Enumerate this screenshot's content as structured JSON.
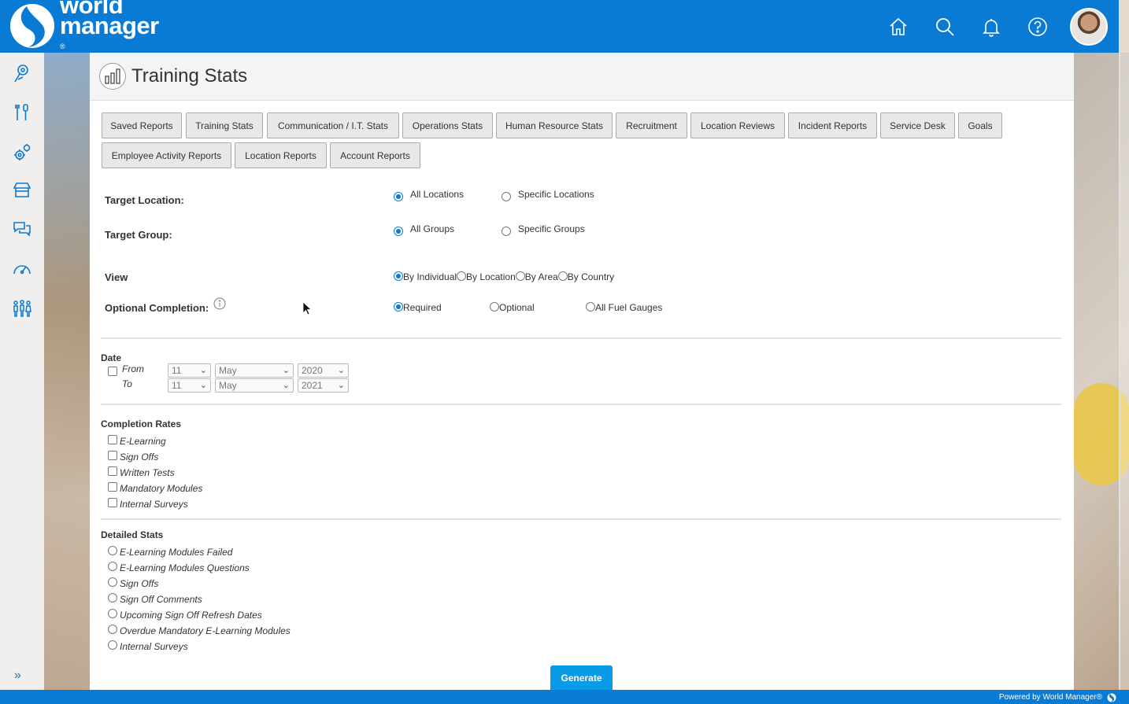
{
  "brand": {
    "line1": "world",
    "line2": "manager",
    "reg": "®"
  },
  "header_icons": [
    "home-icon",
    "search-icon",
    "bell-icon",
    "help-icon"
  ],
  "sidebar_icons": [
    "map-pin-icon",
    "tools-icon",
    "gear-icon",
    "store-icon",
    "chat-icon",
    "gauge-icon",
    "people-icon"
  ],
  "page": {
    "title": "Training Stats"
  },
  "tabs": [
    "Saved Reports",
    "Training Stats",
    "Communication / I.T. Stats",
    "Operations Stats",
    "Human Resource Stats",
    "Recruitment",
    "Location Reviews",
    "Incident Reports",
    "Service Desk",
    "Goals",
    "Employee Activity Reports",
    "Location Reports",
    "Account Reports"
  ],
  "target_location": {
    "label": "Target Location:",
    "options": [
      "All Locations",
      "Specific Locations"
    ],
    "selected": 0
  },
  "target_group": {
    "label": "Target Group:",
    "options": [
      "All Groups",
      "Specific Groups"
    ],
    "selected": 0
  },
  "view": {
    "label": "View",
    "options": [
      "By Individual",
      "By Location",
      "By Area",
      "By Country"
    ],
    "selected": 0
  },
  "optional_completion": {
    "label": "Optional Completion:",
    "options": [
      "Required",
      "Optional",
      "All Fuel Gauges"
    ],
    "selected": 0
  },
  "date": {
    "label": "Date",
    "from_label": "From",
    "to_label": "To",
    "from": {
      "day": "11",
      "month": "May",
      "year": "2020"
    },
    "to": {
      "day": "11",
      "month": "May",
      "year": "2021"
    }
  },
  "completion_rates": {
    "label": "Completion Rates",
    "items": [
      "E-Learning",
      "Sign Offs",
      "Written Tests",
      "Mandatory Modules",
      "Internal Surveys"
    ]
  },
  "detailed_stats": {
    "label": "Detailed Stats",
    "items": [
      "E-Learning Modules Failed",
      "E-Learning Modules Questions",
      "Sign Offs",
      "Sign Off Comments",
      "Upcoming Sign Off Refresh Dates",
      "Overdue Mandatory E-Learning Modules",
      "Internal Surveys"
    ]
  },
  "generate_label": "Generate",
  "footer": {
    "text": "Powered by World Manager®"
  },
  "colors": {
    "brand_blue": "#0a7bd4",
    "generate_blue": "#0a9be8"
  }
}
